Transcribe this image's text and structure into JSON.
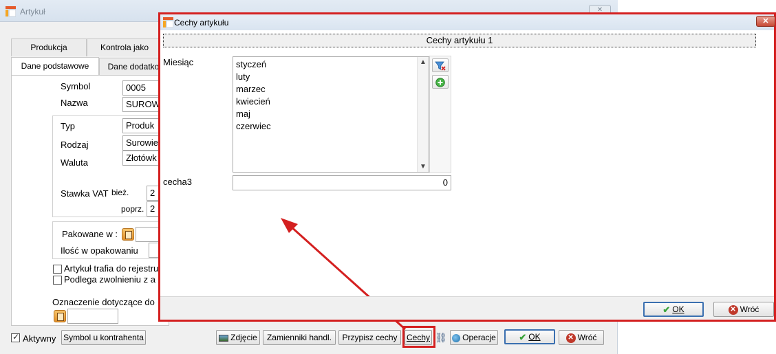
{
  "background_window": {
    "title": "Artykuł",
    "close_label": "✕",
    "tabs_row1": [
      "Produkcja",
      "Kontrola jako"
    ],
    "tabs_row2": [
      "Dane podstawowe",
      "Dane dodatko"
    ],
    "fields": {
      "symbol_label": "Symbol",
      "symbol_value": "0005",
      "nazwa_label": "Nazwa",
      "nazwa_value": "SUROW",
      "typ_label": "Typ",
      "typ_value": "Produk",
      "rodzaj_label": "Rodzaj",
      "rodzaj_value": "Surowie",
      "waluta_label": "Waluta",
      "waluta_value": "Złotówk",
      "stawka_vat_label": "Stawka VAT",
      "biez_label": "bież.",
      "biez_value": "2",
      "poprz_label": "poprz.",
      "poprz_value": "2",
      "pakowane_label": "Pakowane w :",
      "ilosc_label": "Ilość w opakowaniu",
      "checkbox1_label": "Artykuł trafia do rejestru",
      "checkbox2_label": "Podlega zwolnieniu z a",
      "oznaczenie_label": "Oznaczenie dotyczące do"
    },
    "bottom": {
      "aktywny_label": "Aktywny",
      "aktywny_checked": true,
      "symbol_u_kontrahenta": "Symbol u kontrahenta",
      "zdjecie": "Zdjęcie",
      "zamienniki": "Zamienniki handl.",
      "przypisz_cechy": "Przypisz cechy",
      "cechy": "Cechy",
      "operacje": "Operacje",
      "ok": "OK",
      "wroc": "Wróć"
    }
  },
  "dialog": {
    "title": "Cechy artykułu",
    "close_label": "✕",
    "section_title": "Cechy artykułu 1",
    "miesiac_label": "Miesiąc",
    "miesiac_items": [
      "styczeń",
      "luty",
      "marzec",
      "kwiecień",
      "maj",
      "czerwiec"
    ],
    "cecha3_label": "cecha3",
    "cecha3_value": "0",
    "ok": "OK",
    "wroc": "Wróć"
  },
  "colors": {
    "highlight_red": "#d42020",
    "ok_green": "#3aa33a",
    "focus_blue": "#3a6fb0"
  }
}
